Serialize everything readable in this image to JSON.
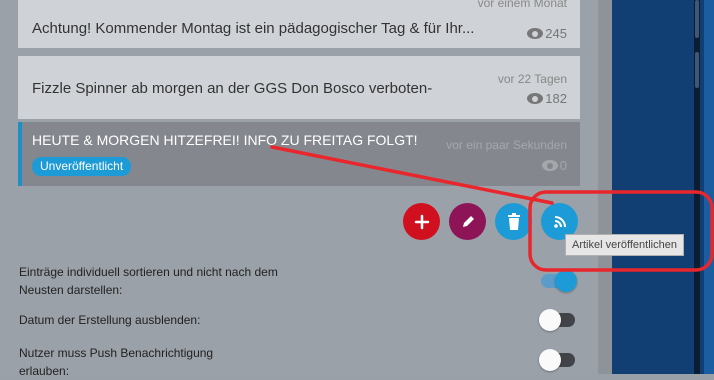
{
  "articles": [
    {
      "title": "Achtung! Kommender Montag ist ein pädagogischer Tag & für Ihr...",
      "time": "vor einem Monat",
      "views": "245"
    },
    {
      "title": "Fizzle Spinner ab morgen an der GGS Don Bosco verboten-",
      "time": "vor 22 Tagen",
      "views": "182"
    },
    {
      "title": "HEUTE & MORGEN HITZEFREI! INFO ZU FREITAG FOLGT!",
      "time": "vor ein paar Sekunden",
      "views": "0",
      "badge": "Unveröffentlicht"
    }
  ],
  "fab": {
    "add_icon": "plus-icon",
    "edit_icon": "pencil-icon",
    "delete_icon": "trash-icon",
    "publish_icon": "rss-icon",
    "colors": {
      "add": "#d0101e",
      "edit": "#8e1458",
      "delete": "#1d9bd6",
      "publish": "#1d9bd6"
    }
  },
  "tooltip": {
    "text": "Artikel veröffentlichen"
  },
  "settings": [
    {
      "label": "Einträge individuell sortieren und nicht nach dem Neusten darstellen:",
      "on": true
    },
    {
      "label": "Datum der Erstellung ausblenden:",
      "on": false
    },
    {
      "label": "Nutzer muss Push Benachrichtigung erlauben:",
      "on": false
    }
  ],
  "annotation_color": "#e8262b"
}
